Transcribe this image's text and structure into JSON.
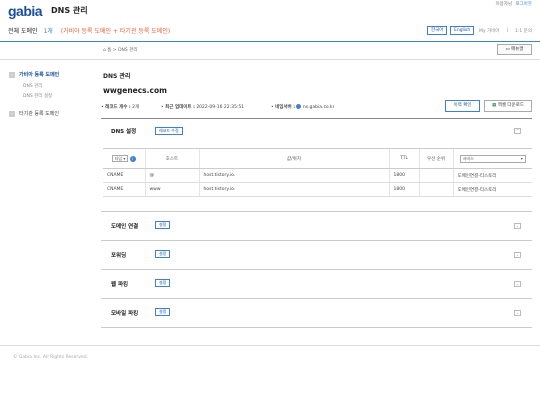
{
  "header": {
    "logo": "gabia",
    "title": "DNS 관리",
    "user_link": "이용자님",
    "logout": "로그아웃"
  },
  "summary": {
    "label": "전체 도메인",
    "count": "1개",
    "detail": "(가비아 등록 도메인 + 타기관 등록 도메인)"
  },
  "top_nav": {
    "lang_kr": "한국어",
    "lang_en": "English",
    "my_gabia": "My 가비아",
    "separator": "|",
    "ticket": "1:1 문의"
  },
  "breadcrumb": "홈 > DNS 관리",
  "manual_button": "매뉴얼",
  "sidebar": {
    "items": [
      {
        "label": "가비아 등록 도메인",
        "active": true
      },
      {
        "label": "타기관 등록 도메인",
        "active": false
      }
    ],
    "subitems": [
      "DNS 관리",
      "DNS 관리 설정"
    ]
  },
  "main": {
    "title": "DNS 관리",
    "domain": "wwgenecs.com",
    "info": {
      "record_label": "레코드 개수 :",
      "record_count": "2개",
      "updated_label": "최근 업데이트 :",
      "updated": "2022-09-16 22:35:51",
      "ns_label": "네임서버 :",
      "ns_value": "ns.gabia.co.kr"
    },
    "history_button": "이력 확인",
    "download_button": "엑셀 다운로드"
  },
  "dns_section": {
    "title": "DNS 설정",
    "edit_button": "레코드 수정",
    "columns": [
      "타입",
      "호스트",
      "값/위치",
      "TTL",
      "우선 순위",
      "서비스"
    ],
    "type_select": "타입",
    "rows": [
      {
        "type": "CNAME",
        "host": "@",
        "value": "host.tistory.io.",
        "ttl": "1800",
        "priority": "",
        "service": "도메인연결-티스토리"
      },
      {
        "type": "CNAME",
        "host": "www",
        "value": "host.tistory.io.",
        "ttl": "1800",
        "priority": "",
        "service": "도메인연결-티스토리"
      }
    ]
  },
  "sections": [
    {
      "title": "도메인 연결",
      "button": "설정"
    },
    {
      "title": "포워딩",
      "button": "설정"
    },
    {
      "title": "웹 파킹",
      "button": "설정"
    },
    {
      "title": "모바일 파킹",
      "button": "설정"
    }
  ],
  "footer": "© Gabia Inc. All Rights Reserved.",
  "colors": {
    "accent": "#3f7fd6",
    "brand": "#1a4f9c",
    "highlight": "#e65f3a"
  }
}
